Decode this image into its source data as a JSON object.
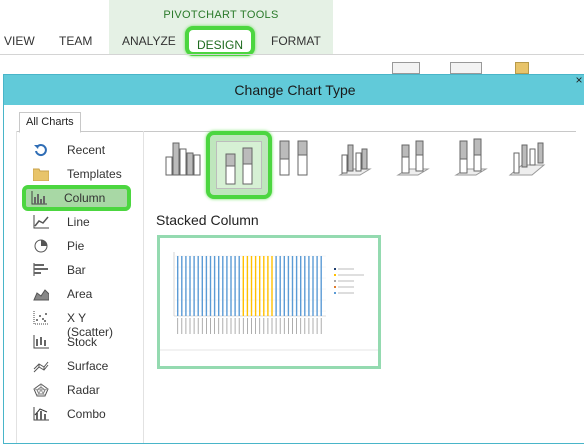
{
  "ribbon": {
    "context_label": "PIVOTCHART TOOLS",
    "tabs": {
      "view": "VIEW",
      "team": "TEAM",
      "analyze": "ANALYZE",
      "design": "DESIGN",
      "format": "FORMAT"
    }
  },
  "dialog": {
    "title": "Change Chart Type",
    "close_glyph": "×",
    "tab_label": "All Charts",
    "categories": [
      {
        "label": "Recent",
        "icon": "recent-icon"
      },
      {
        "label": "Templates",
        "icon": "templates-folder-icon"
      },
      {
        "label": "Column",
        "icon": "column-chart-icon",
        "selected": true
      },
      {
        "label": "Line",
        "icon": "line-chart-icon"
      },
      {
        "label": "Pie",
        "icon": "pie-chart-icon"
      },
      {
        "label": "Bar",
        "icon": "bar-chart-icon"
      },
      {
        "label": "Area",
        "icon": "area-chart-icon"
      },
      {
        "label": "X Y (Scatter)",
        "icon": "scatter-chart-icon"
      },
      {
        "label": "Stock",
        "icon": "stock-chart-icon"
      },
      {
        "label": "Surface",
        "icon": "surface-chart-icon"
      },
      {
        "label": "Radar",
        "icon": "radar-chart-icon"
      },
      {
        "label": "Combo",
        "icon": "combo-chart-icon"
      }
    ],
    "subtypes": [
      {
        "name": "clustered-column",
        "selected": false
      },
      {
        "name": "stacked-column",
        "selected": true
      },
      {
        "name": "100-stacked-column",
        "selected": false
      },
      {
        "name": "3d-clustered-column",
        "selected": false
      },
      {
        "name": "3d-stacked-column",
        "selected": false
      },
      {
        "name": "3d-100-stacked-column",
        "selected": false
      },
      {
        "name": "3d-column",
        "selected": false
      }
    ],
    "selected_subtype_title": "Stacked Column"
  },
  "colors": {
    "highlight": "#4cd640",
    "titlebar": "#61cad9",
    "context_band": "#e5f1e5",
    "series_blue": "#5b9bd5",
    "series_yellow": "#ffc000"
  }
}
